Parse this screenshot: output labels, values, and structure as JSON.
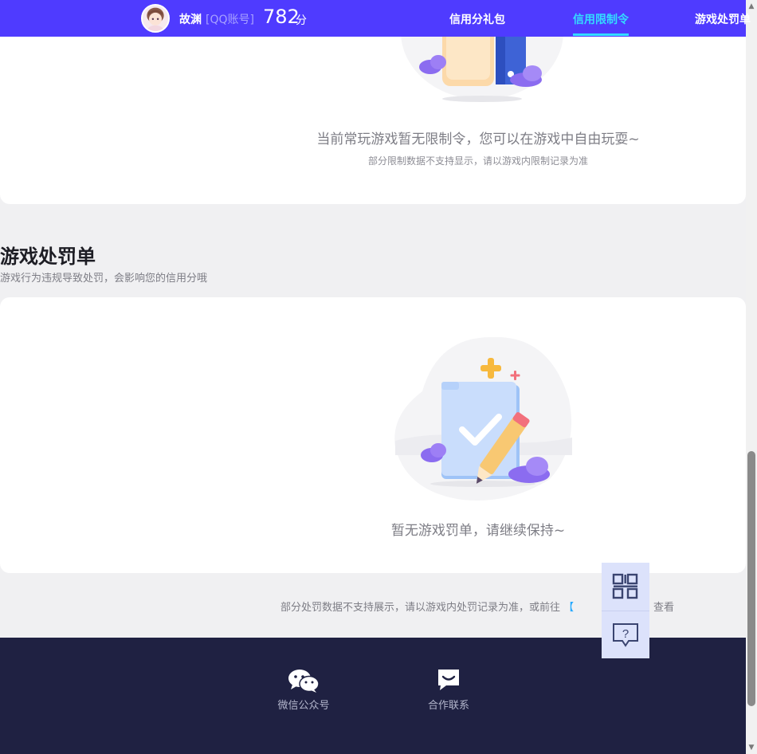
{
  "header": {
    "username": "故渊",
    "account_type": "[QQ账号]",
    "score": "782",
    "score_unit": "分",
    "tabs": [
      {
        "label": "信用分礼包",
        "active": false
      },
      {
        "label": "信用限制令",
        "active": true
      },
      {
        "label": "游戏处罚单",
        "active": false
      }
    ]
  },
  "restriction_card": {
    "message": "当前常玩游戏暂无限制令，您可以在游戏中自由玩耍~",
    "note": "部分限制数据不支持显示，请以游戏内限制记录为准"
  },
  "penalty_section": {
    "title": "游戏处罚单",
    "subtitle": "游戏行为违规导致处罚，会影响您的信用分哦",
    "empty_message": "暂无游戏罚单，请继续保持~"
  },
  "bottom_note": {
    "text": "部分处罚数据不支持展示，请以游戏内处罚记录为准，或前往",
    "link": "【",
    "tail": "查看"
  },
  "footer": {
    "items": [
      {
        "label": "微信公众号",
        "icon": "wechat-icon"
      },
      {
        "label": "合作联系",
        "icon": "chat-icon"
      }
    ]
  },
  "colors": {
    "header_bg": "#4f3bff",
    "accent": "#33dcff",
    "footer_bg": "#1f2142",
    "link": "#25a9ff"
  }
}
